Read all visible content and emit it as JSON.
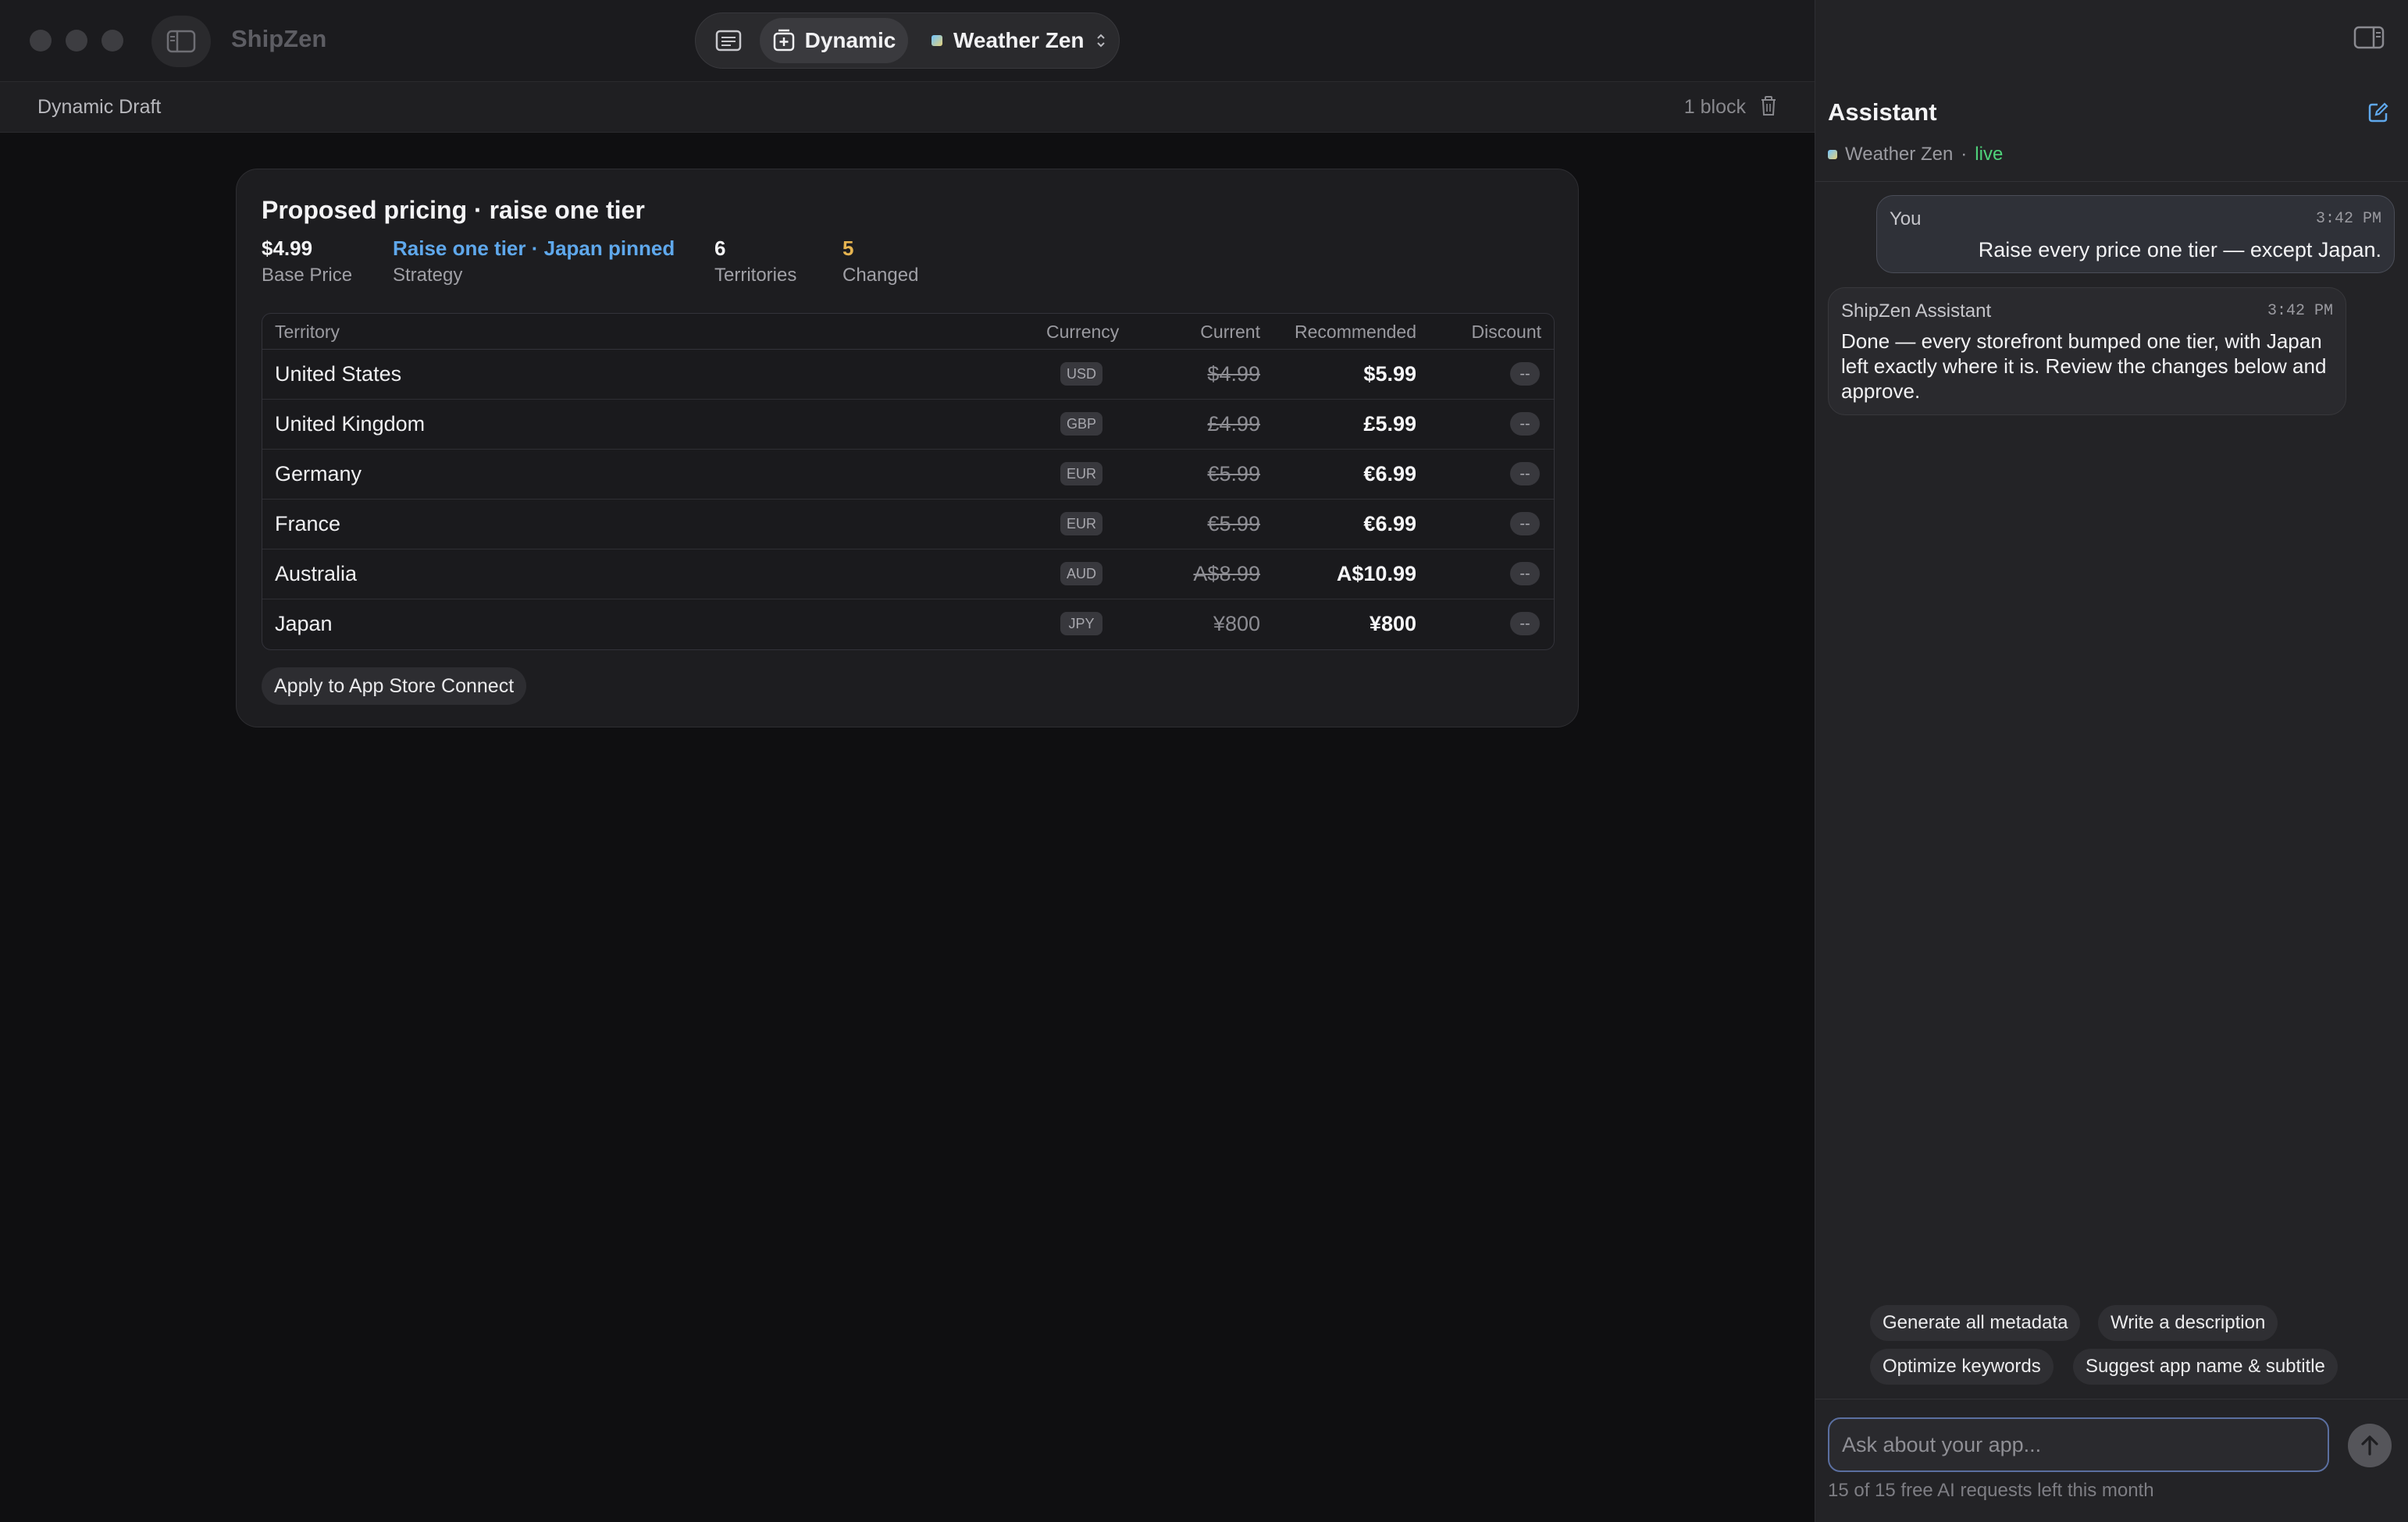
{
  "window": {
    "app_name": "ShipZen",
    "segments": {
      "dynamic_label": "Dynamic"
    },
    "app_selector": {
      "label": "Weather Zen"
    }
  },
  "subbar": {
    "title": "Dynamic Draft",
    "block_count": "1 block"
  },
  "pricing": {
    "title": "Proposed pricing · raise one tier",
    "stats": [
      {
        "value": "$4.99",
        "label": "Base Price",
        "color": "#f4f4f6"
      },
      {
        "value": "Raise one tier · Japan pinned",
        "label": "Strategy",
        "color": "#5fa8ec"
      },
      {
        "value": "6",
        "label": "Territories",
        "color": "#f4f4f6"
      },
      {
        "value": "5",
        "label": "Changed",
        "color": "#e6b450"
      }
    ],
    "columns": [
      "Territory",
      "Currency",
      "Current",
      "Recommended",
      "Discount"
    ],
    "rows": [
      {
        "territory": "United States",
        "currency": "USD",
        "current": "$4.99",
        "recommended": "$5.99",
        "discount": "--",
        "changed": true
      },
      {
        "territory": "United Kingdom",
        "currency": "GBP",
        "current": "£4.99",
        "recommended": "£5.99",
        "discount": "--",
        "changed": true
      },
      {
        "territory": "Germany",
        "currency": "EUR",
        "current": "€5.99",
        "recommended": "€6.99",
        "discount": "--",
        "changed": true
      },
      {
        "territory": "France",
        "currency": "EUR",
        "current": "€5.99",
        "recommended": "€6.99",
        "discount": "--",
        "changed": true
      },
      {
        "territory": "Australia",
        "currency": "AUD",
        "current": "A$8.99",
        "recommended": "A$10.99",
        "discount": "--",
        "changed": true
      },
      {
        "territory": "Japan",
        "currency": "JPY",
        "current": "¥800",
        "recommended": "¥800",
        "discount": "--",
        "changed": false
      }
    ],
    "apply_label": "Apply to App Store Connect"
  },
  "assistant": {
    "title": "Assistant",
    "app_name": "Weather Zen",
    "separator": "·",
    "status": "live",
    "messages": [
      {
        "author": "You",
        "time": "3:42 PM",
        "text": "Raise every price one tier — except Japan."
      },
      {
        "author": "ShipZen Assistant",
        "time": "3:42 PM",
        "text": "Done — every storefront bumped one tier, with Japan left exactly where it is. Review the changes below and approve."
      }
    ],
    "suggestions": [
      "Generate all metadata",
      "Write a description",
      "Optimize keywords",
      "Suggest app name & subtitle"
    ],
    "input_placeholder": "Ask about your app...",
    "quota": "15 of 15 free AI requests left this month"
  },
  "icons": [
    "sidebar-icon",
    "document-icon",
    "dynamic-icon",
    "chevron-updown-icon",
    "trash-icon",
    "panel-right-icon",
    "compose-icon",
    "arrow-up-icon"
  ]
}
